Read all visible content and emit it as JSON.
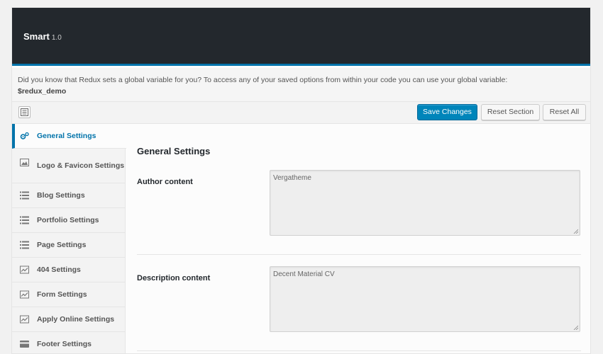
{
  "header": {
    "title": "Smart",
    "version": "1.0"
  },
  "notice": {
    "text": "Did you know that Redux sets a global variable for you? To access any of your saved options from within your code you can use your global variable:",
    "variable": "$redux_demo"
  },
  "toolbar": {
    "save_label": "Save Changes",
    "reset_section_label": "Reset Section",
    "reset_all_label": "Reset All"
  },
  "sidebar": {
    "items": [
      {
        "label": "General Settings",
        "icon": "gears-icon",
        "active": true
      },
      {
        "label": "Logo & Favicon Settings",
        "icon": "image-icon",
        "active": false
      },
      {
        "label": "Blog Settings",
        "icon": "list-icon",
        "active": false
      },
      {
        "label": "Portfolio Settings",
        "icon": "list-icon",
        "active": false
      },
      {
        "label": "Page Settings",
        "icon": "list-icon",
        "active": false
      },
      {
        "label": "404 Settings",
        "icon": "chart-icon",
        "active": false
      },
      {
        "label": "Form Settings",
        "icon": "chart-icon",
        "active": false
      },
      {
        "label": "Apply Online Settings",
        "icon": "chart-icon",
        "active": false
      },
      {
        "label": "Footer Settings",
        "icon": "card-icon",
        "active": false
      }
    ]
  },
  "main": {
    "section_title": "General Settings",
    "fields": [
      {
        "label": "Author content",
        "value": "Vergatheme"
      },
      {
        "label": "Description content",
        "value": "Decent Material CV"
      }
    ]
  },
  "colors": {
    "accent": "#0073aa",
    "primary_button": "#0085ba",
    "header_bg": "#23282d"
  }
}
